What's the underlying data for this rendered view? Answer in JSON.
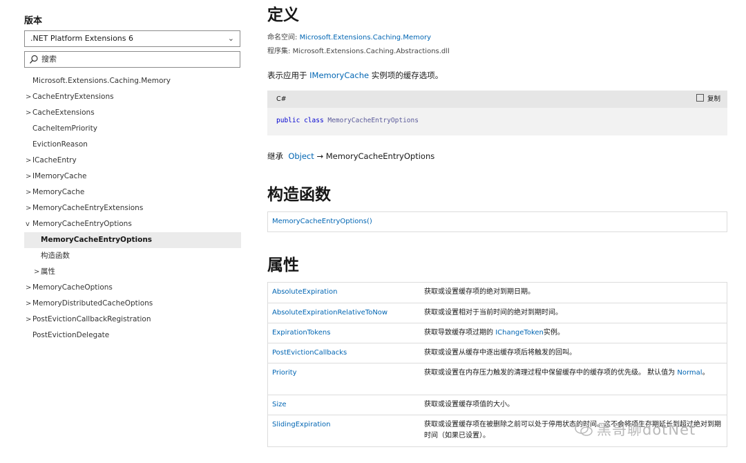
{
  "sidebar": {
    "version_label": "版本",
    "version_selected": ".NET Platform Extensions 6",
    "search_placeholder": "搜索",
    "items": [
      {
        "label": "Microsoft.Extensions.Caching.Memory",
        "toggle": "",
        "level": 1,
        "active": false
      },
      {
        "label": "CacheEntryExtensions",
        "toggle": ">",
        "level": 1,
        "active": false
      },
      {
        "label": "CacheExtensions",
        "toggle": ">",
        "level": 1,
        "active": false
      },
      {
        "label": "CacheItemPriority",
        "toggle": "",
        "level": 1,
        "active": false
      },
      {
        "label": "EvictionReason",
        "toggle": "",
        "level": 1,
        "active": false
      },
      {
        "label": "ICacheEntry",
        "toggle": ">",
        "level": 1,
        "active": false
      },
      {
        "label": "IMemoryCache",
        "toggle": ">",
        "level": 1,
        "active": false
      },
      {
        "label": "MemoryCache",
        "toggle": ">",
        "level": 1,
        "active": false
      },
      {
        "label": "MemoryCacheEntryExtensions",
        "toggle": ">",
        "level": 1,
        "active": false
      },
      {
        "label": "MemoryCacheEntryOptions",
        "toggle": "v",
        "level": 1,
        "active": false
      },
      {
        "label": "MemoryCacheEntryOptions",
        "toggle": "",
        "level": 2,
        "active": true
      },
      {
        "label": "构造函数",
        "toggle": "",
        "level": 2,
        "active": false
      },
      {
        "label": "属性",
        "toggle": ">",
        "level": 2,
        "active": false
      },
      {
        "label": "MemoryCacheOptions",
        "toggle": ">",
        "level": 1,
        "active": false
      },
      {
        "label": "MemoryDistributedCacheOptions",
        "toggle": ">",
        "level": 1,
        "active": false
      },
      {
        "label": "PostEvictionCallbackRegistration",
        "toggle": ">",
        "level": 1,
        "active": false
      },
      {
        "label": "PostEvictionDelegate",
        "toggle": "",
        "level": 1,
        "active": false
      }
    ]
  },
  "main": {
    "definition_heading": "定义",
    "namespace_label": "命名空间:",
    "namespace_value": "Microsoft.Extensions.Caching.Memory",
    "assembly_label": "程序集:",
    "assembly_value": "Microsoft.Extensions.Caching.Abstractions.dll",
    "summary_prefix": "表示应用于",
    "summary_link": "IMemoryCache",
    "summary_suffix": "实例项的缓存选项。",
    "code": {
      "lang": "C#",
      "copy_label": "复制",
      "kw1": "public",
      "kw2": "class",
      "type_name": "MemoryCacheEntryOptions"
    },
    "inherit_label": "继承",
    "inherit_base": "Object",
    "inherit_arrow": "→",
    "inherit_self": "MemoryCacheEntryOptions",
    "constructors_heading": "构造函数",
    "constructor_link": "MemoryCacheEntryOptions()",
    "properties_heading": "属性",
    "properties": [
      {
        "name": "AbsoluteExpiration",
        "desc": "获取或设置缓存项的绝对到期日期。"
      },
      {
        "name": "AbsoluteExpirationRelativeToNow",
        "desc": "获取或设置相对于当前时间的绝对到期时间。"
      },
      {
        "name": "ExpirationTokens",
        "desc": "获取导致缓存项过期的",
        "link": "IChangeToken",
        "desc2": "实例。"
      },
      {
        "name": "PostEvictionCallbacks",
        "desc": "获取或设置从缓存中逐出缓存项后将触发的回叫。"
      },
      {
        "name": "Priority",
        "desc": "获取或设置在内存压力触发的清理过程中保留缓存中的缓存项的优先级。 默认值为",
        "link": "Normal",
        "desc2": "。"
      },
      {
        "name": "Size",
        "desc": "获取或设置缓存项值的大小。"
      },
      {
        "name": "SlidingExpiration",
        "desc": "获取或设置缓存项在被删除之前可以处于停用状态的时间。这不会将项生存期延长到超过绝对到期时间（如果已设置）。"
      }
    ]
  },
  "watermark": "黑哥聊dotNet"
}
